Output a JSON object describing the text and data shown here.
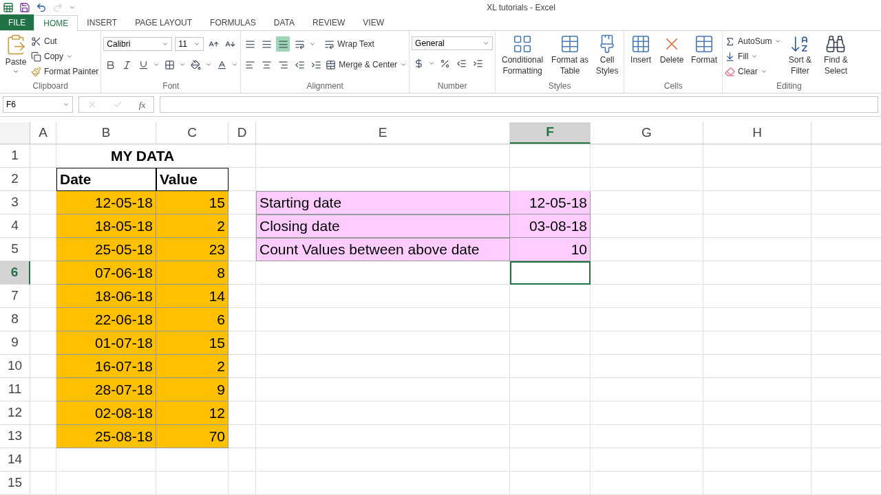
{
  "window": {
    "title": "XL tutorials - Excel"
  },
  "tabs": [
    {
      "label": "FILE",
      "kind": "file",
      "selected": false
    },
    {
      "label": "HOME",
      "kind": "tab",
      "selected": true
    },
    {
      "label": "INSERT",
      "kind": "tab",
      "selected": false
    },
    {
      "label": "PAGE LAYOUT",
      "kind": "tab",
      "selected": false
    },
    {
      "label": "FORMULAS",
      "kind": "tab",
      "selected": false
    },
    {
      "label": "DATA",
      "kind": "tab",
      "selected": false
    },
    {
      "label": "REVIEW",
      "kind": "tab",
      "selected": false
    },
    {
      "label": "VIEW",
      "kind": "tab",
      "selected": false
    }
  ],
  "ribbon": {
    "clipboard": {
      "label": "Clipboard",
      "paste": "Paste",
      "cut": "Cut",
      "copy": "Copy",
      "format_painter": "Format Painter"
    },
    "font": {
      "label": "Font",
      "font_name": "Calibri",
      "font_size": "11"
    },
    "alignment": {
      "label": "Alignment",
      "wrap_text": "Wrap Text",
      "merge_center": "Merge & Center",
      "vertical_buttons": [
        {
          "selected": false
        },
        {
          "selected": false
        },
        {
          "selected": true
        }
      ]
    },
    "number": {
      "label": "Number",
      "format": "General"
    },
    "styles": {
      "label": "Styles",
      "items": [
        "Conditional Formatting",
        "Format as Table",
        "Cell Styles"
      ]
    },
    "cells": {
      "label": "Cells",
      "items": [
        "Insert",
        "Delete",
        "Format"
      ]
    },
    "editing": {
      "label": "Editing",
      "autosum": "AutoSum",
      "fill": "Fill",
      "clear": "Clear",
      "sort_filter": "Sort & Filter",
      "find_select": "Find & Select"
    }
  },
  "formula_bar": {
    "name_box": "F6",
    "function_label": "fx"
  },
  "columns": [
    {
      "label": "A",
      "selected": false
    },
    {
      "label": "B",
      "selected": false
    },
    {
      "label": "C",
      "selected": false
    },
    {
      "label": "D",
      "selected": false
    },
    {
      "label": "E",
      "selected": false
    },
    {
      "label": "F",
      "selected": true
    },
    {
      "label": "G",
      "selected": false
    },
    {
      "label": "H",
      "selected": false
    }
  ],
  "rows": [
    {
      "number": "1",
      "selected": false,
      "cells": [
        null,
        {
          "text": "MY DATA",
          "kind": "title"
        },
        null,
        null,
        null,
        null,
        null,
        null
      ]
    },
    {
      "number": "2",
      "selected": false,
      "cells": [
        null,
        {
          "text": "Date",
          "kind": "header"
        },
        {
          "text": "Value",
          "kind": "header"
        },
        null,
        null,
        null,
        null,
        null
      ]
    },
    {
      "number": "3",
      "selected": false,
      "cells": [
        null,
        {
          "text": "12-05-18",
          "kind": "number",
          "color": "#ffc000"
        },
        {
          "text": "15",
          "kind": "number",
          "color": "#ffc000"
        },
        null,
        {
          "text": "Starting date",
          "kind": "text",
          "color": "#ffccff"
        },
        {
          "text": "12-05-18",
          "kind": "number",
          "color": "#ffccff"
        },
        null,
        null
      ]
    },
    {
      "number": "4",
      "selected": false,
      "cells": [
        null,
        {
          "text": "18-05-18",
          "kind": "number",
          "color": "#ffc000"
        },
        {
          "text": "2",
          "kind": "number",
          "color": "#ffc000"
        },
        null,
        {
          "text": "Closing date",
          "kind": "text",
          "color": "#ffccff"
        },
        {
          "text": "03-08-18",
          "kind": "number",
          "color": "#ffccff"
        },
        null,
        null
      ]
    },
    {
      "number": "5",
      "selected": false,
      "cells": [
        null,
        {
          "text": "25-05-18",
          "kind": "number",
          "color": "#ffc000"
        },
        {
          "text": "23",
          "kind": "number",
          "color": "#ffc000"
        },
        null,
        {
          "text": "Count Values between above date",
          "kind": "text",
          "color": "#ffccff"
        },
        {
          "text": "10",
          "kind": "number",
          "color": "#ffccff"
        },
        null,
        null
      ]
    },
    {
      "number": "6",
      "selected": true,
      "cells": [
        null,
        {
          "text": "07-06-18",
          "kind": "number",
          "color": "#ffc000"
        },
        {
          "text": "8",
          "kind": "number",
          "color": "#ffc000"
        },
        null,
        null,
        null,
        null,
        null
      ]
    },
    {
      "number": "7",
      "selected": false,
      "cells": [
        null,
        {
          "text": "18-06-18",
          "kind": "number",
          "color": "#ffc000"
        },
        {
          "text": "14",
          "kind": "number",
          "color": "#ffc000"
        },
        null,
        null,
        null,
        null,
        null
      ]
    },
    {
      "number": "8",
      "selected": false,
      "cells": [
        null,
        {
          "text": "22-06-18",
          "kind": "number",
          "color": "#ffc000"
        },
        {
          "text": "6",
          "kind": "number",
          "color": "#ffc000"
        },
        null,
        null,
        null,
        null,
        null
      ]
    },
    {
      "number": "9",
      "selected": false,
      "cells": [
        null,
        {
          "text": "01-07-18",
          "kind": "number",
          "color": "#ffc000"
        },
        {
          "text": "15",
          "kind": "number",
          "color": "#ffc000"
        },
        null,
        null,
        null,
        null,
        null
      ]
    },
    {
      "number": "10",
      "selected": false,
      "cells": [
        null,
        {
          "text": "16-07-18",
          "kind": "number",
          "color": "#ffc000"
        },
        {
          "text": "2",
          "kind": "number",
          "color": "#ffc000"
        },
        null,
        null,
        null,
        null,
        null
      ]
    },
    {
      "number": "11",
      "selected": false,
      "cells": [
        null,
        {
          "text": "28-07-18",
          "kind": "number",
          "color": "#ffc000"
        },
        {
          "text": "9",
          "kind": "number",
          "color": "#ffc000"
        },
        null,
        null,
        null,
        null,
        null
      ]
    },
    {
      "number": "12",
      "selected": false,
      "cells": [
        null,
        {
          "text": "02-08-18",
          "kind": "number",
          "color": "#ffc000"
        },
        {
          "text": "12",
          "kind": "number",
          "color": "#ffc000"
        },
        null,
        null,
        null,
        null,
        null
      ]
    },
    {
      "number": "13",
      "selected": false,
      "cells": [
        null,
        {
          "text": "25-08-18",
          "kind": "number",
          "color": "#ffc000"
        },
        {
          "text": "70",
          "kind": "number",
          "color": "#ffc000"
        },
        null,
        null,
        null,
        null,
        null
      ]
    },
    {
      "number": "14",
      "selected": false,
      "cells": [
        null,
        null,
        null,
        null,
        null,
        null,
        null,
        null
      ]
    },
    {
      "number": "15",
      "selected": false,
      "cells": [
        null,
        null,
        null,
        null,
        null,
        null,
        null,
        null
      ]
    }
  ]
}
